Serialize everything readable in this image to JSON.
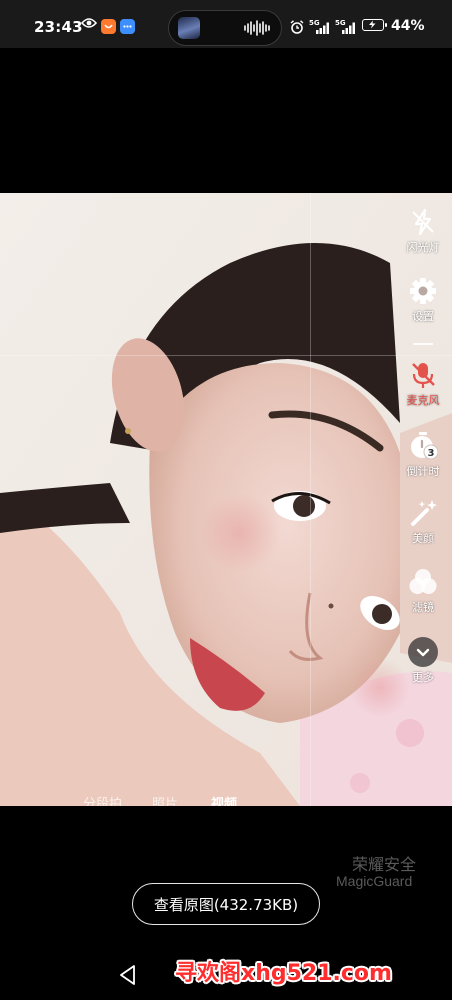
{
  "status_bar": {
    "time": "23:43",
    "network_1": "5G",
    "network_2": "5G",
    "battery": "44%",
    "icons": [
      "eye-icon",
      "taobao-icon",
      "message-icon",
      "alarm-icon",
      "battery-charging-icon"
    ]
  },
  "toolbar": {
    "flash": "闪光灯",
    "settings": "设置",
    "microphone": "麦克风",
    "countdown": "倒计时",
    "countdown_value": "3",
    "beauty": "美颜",
    "filter": "滤镜",
    "more": "更多"
  },
  "modes": {
    "segment": "分段拍",
    "photo": "照片",
    "video": "视频"
  },
  "watermark": {
    "cn": "荣耀安全",
    "en": "MagicGuard"
  },
  "view_original_button": "查看原图(432.73KB)",
  "site_watermark": "寻欢阁xhg521.com",
  "colors": {
    "mic_muted": "#e3524b",
    "site_watermark": "#ff2d2d",
    "background": "#000000"
  }
}
